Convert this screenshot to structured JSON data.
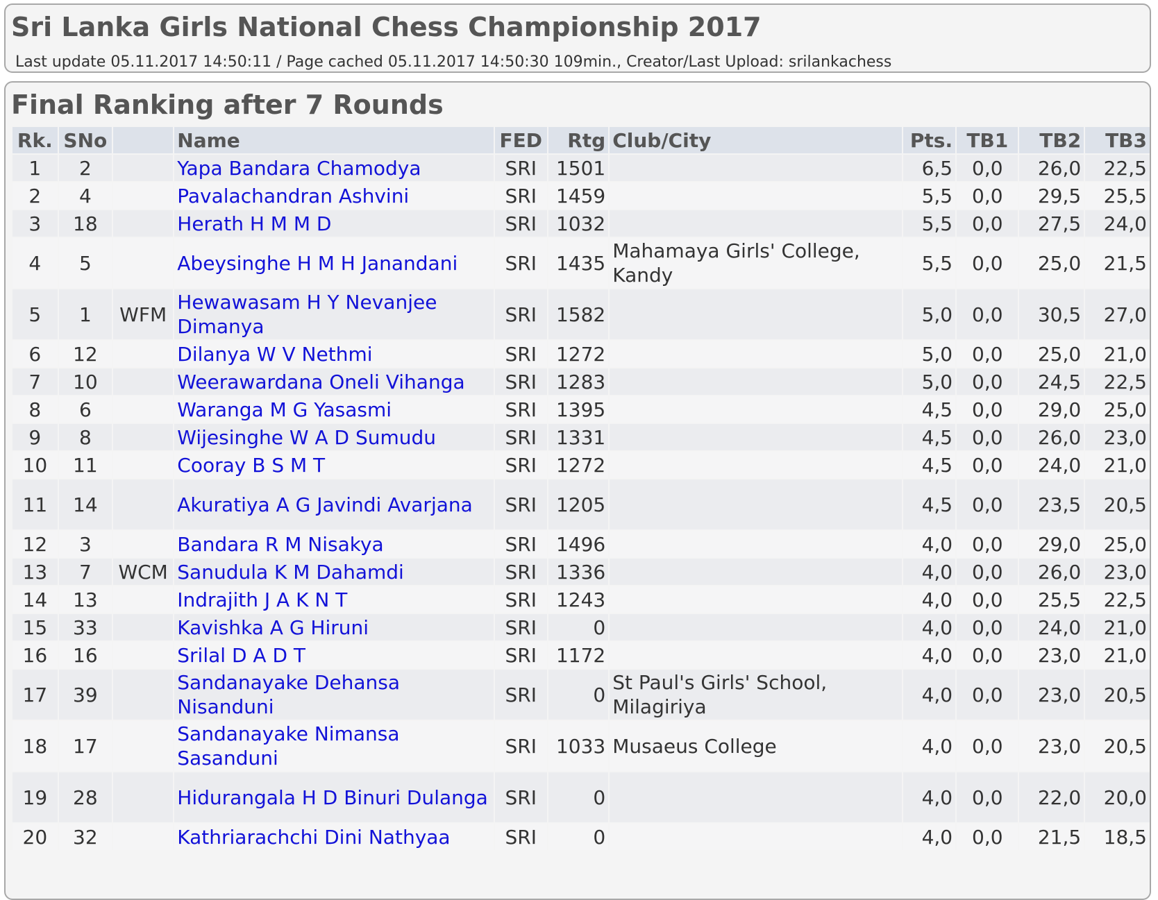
{
  "header": {
    "title": "Sri Lanka Girls National Chess Championship 2017",
    "subtitle": "Last update 05.11.2017 14:50:11 / Page cached 05.11.2017 14:50:30 109min., Creator/Last Upload: srilankachess"
  },
  "ranking": {
    "title": "Final Ranking after 7 Rounds",
    "columns": [
      "Rk.",
      "SNo",
      "",
      "Name",
      "FED",
      "Rtg",
      "Club/City",
      "Pts.",
      "TB1",
      "TB2",
      "TB3"
    ],
    "rows": [
      {
        "rk": "1",
        "sno": "2",
        "title": "",
        "name": "Yapa Bandara Chamodya",
        "fed": "SRI",
        "rtg": "1501",
        "club": "",
        "pts": "6,5",
        "tb1": "0,0",
        "tb2": "26,0",
        "tb3": "22,5"
      },
      {
        "rk": "2",
        "sno": "4",
        "title": "",
        "name": "Pavalachandran Ashvini",
        "fed": "SRI",
        "rtg": "1459",
        "club": "",
        "pts": "5,5",
        "tb1": "0,0",
        "tb2": "29,5",
        "tb3": "25,5"
      },
      {
        "rk": "3",
        "sno": "18",
        "title": "",
        "name": "Herath H M M D",
        "fed": "SRI",
        "rtg": "1032",
        "club": "",
        "pts": "5,5",
        "tb1": "0,0",
        "tb2": "27,5",
        "tb3": "24,0"
      },
      {
        "rk": "4",
        "sno": "5",
        "title": "",
        "name": "Abeysinghe H M H Janandani",
        "fed": "SRI",
        "rtg": "1435",
        "club": "Mahamaya Girls' College, Kandy",
        "pts": "5,5",
        "tb1": "0,0",
        "tb2": "25,0",
        "tb3": "21,5"
      },
      {
        "rk": "5",
        "sno": "1",
        "title": "WFM",
        "name": "Hewawasam H Y Nevanjee Dimanya",
        "fed": "SRI",
        "rtg": "1582",
        "club": "",
        "pts": "5,0",
        "tb1": "0,0",
        "tb2": "30,5",
        "tb3": "27,0"
      },
      {
        "rk": "6",
        "sno": "12",
        "title": "",
        "name": "Dilanya W V Nethmi",
        "fed": "SRI",
        "rtg": "1272",
        "club": "",
        "pts": "5,0",
        "tb1": "0,0",
        "tb2": "25,0",
        "tb3": "21,0"
      },
      {
        "rk": "7",
        "sno": "10",
        "title": "",
        "name": "Weerawardana Oneli Vihanga",
        "fed": "SRI",
        "rtg": "1283",
        "club": "",
        "pts": "5,0",
        "tb1": "0,0",
        "tb2": "24,5",
        "tb3": "22,5"
      },
      {
        "rk": "8",
        "sno": "6",
        "title": "",
        "name": "Waranga M G Yasasmi",
        "fed": "SRI",
        "rtg": "1395",
        "club": "",
        "pts": "4,5",
        "tb1": "0,0",
        "tb2": "29,0",
        "tb3": "25,0"
      },
      {
        "rk": "9",
        "sno": "8",
        "title": "",
        "name": "Wijesinghe W A D Sumudu",
        "fed": "SRI",
        "rtg": "1331",
        "club": "",
        "pts": "4,5",
        "tb1": "0,0",
        "tb2": "26,0",
        "tb3": "23,0"
      },
      {
        "rk": "10",
        "sno": "11",
        "title": "",
        "name": "Cooray B S M T",
        "fed": "SRI",
        "rtg": "1272",
        "club": "",
        "pts": "4,5",
        "tb1": "0,0",
        "tb2": "24,0",
        "tb3": "21,0"
      },
      {
        "rk": "11",
        "sno": "14",
        "title": "",
        "name": "Akuratiya A G Javindi Avarjana",
        "fed": "SRI",
        "rtg": "1205",
        "club": "",
        "pts": "4,5",
        "tb1": "0,0",
        "tb2": "23,5",
        "tb3": "20,5"
      },
      {
        "rk": "12",
        "sno": "3",
        "title": "",
        "name": "Bandara R M Nisakya",
        "fed": "SRI",
        "rtg": "1496",
        "club": "",
        "pts": "4,0",
        "tb1": "0,0",
        "tb2": "29,0",
        "tb3": "25,0"
      },
      {
        "rk": "13",
        "sno": "7",
        "title": "WCM",
        "name": "Sanudula K M Dahamdi",
        "fed": "SRI",
        "rtg": "1336",
        "club": "",
        "pts": "4,0",
        "tb1": "0,0",
        "tb2": "26,0",
        "tb3": "23,0"
      },
      {
        "rk": "14",
        "sno": "13",
        "title": "",
        "name": "Indrajith J A K N T",
        "fed": "SRI",
        "rtg": "1243",
        "club": "",
        "pts": "4,0",
        "tb1": "0,0",
        "tb2": "25,5",
        "tb3": "22,5"
      },
      {
        "rk": "15",
        "sno": "33",
        "title": "",
        "name": "Kavishka A G Hiruni",
        "fed": "SRI",
        "rtg": "0",
        "club": "",
        "pts": "4,0",
        "tb1": "0,0",
        "tb2": "24,0",
        "tb3": "21,0"
      },
      {
        "rk": "16",
        "sno": "16",
        "title": "",
        "name": "Srilal D A D T",
        "fed": "SRI",
        "rtg": "1172",
        "club": "",
        "pts": "4,0",
        "tb1": "0,0",
        "tb2": "23,0",
        "tb3": "21,0"
      },
      {
        "rk": "17",
        "sno": "39",
        "title": "",
        "name": "Sandanayake Dehansa Nisanduni",
        "fed": "SRI",
        "rtg": "0",
        "club": "St Paul's Girls' School, Milagiriya",
        "pts": "4,0",
        "tb1": "0,0",
        "tb2": "23,0",
        "tb3": "20,5"
      },
      {
        "rk": "18",
        "sno": "17",
        "title": "",
        "name": "Sandanayake Nimansa Sasanduni",
        "fed": "SRI",
        "rtg": "1033",
        "club": "Musaeus College",
        "pts": "4,0",
        "tb1": "0,0",
        "tb2": "23,0",
        "tb3": "20,5"
      },
      {
        "rk": "19",
        "sno": "28",
        "title": "",
        "name": "Hidurangala H D Binuri Dulanga",
        "fed": "SRI",
        "rtg": "0",
        "club": "",
        "pts": "4,0",
        "tb1": "0,0",
        "tb2": "22,0",
        "tb3": "20,0"
      },
      {
        "rk": "20",
        "sno": "32",
        "title": "",
        "name": "Kathriarachchi Dini Nathyaa",
        "fed": "SRI",
        "rtg": "0",
        "club": "",
        "pts": "4,0",
        "tb1": "0,0",
        "tb2": "21,5",
        "tb3": "18,5"
      }
    ]
  }
}
